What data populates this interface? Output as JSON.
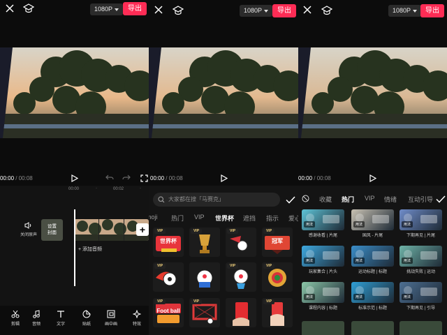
{
  "resolution": "1080P",
  "export_label": "导出",
  "time": {
    "current": "00:00",
    "total": "/ 00:08"
  },
  "ruler": {
    "mark1": "00:00",
    "mark2": "00:02"
  },
  "editor": {
    "mute_label": "关闭原声",
    "cover_label_1": "设置",
    "cover_label_2": "封面",
    "add_audio_label": "+ 添加音频",
    "add_clip_symbol": "+"
  },
  "toolbar": [
    {
      "icon": "scissors-icon",
      "label": "剪辑"
    },
    {
      "icon": "music-note-icon",
      "label": "音频"
    },
    {
      "icon": "text-icon",
      "label": "文字"
    },
    {
      "icon": "sticker-icon",
      "label": "贴纸"
    },
    {
      "icon": "picture-in-picture-icon",
      "label": "画中画"
    },
    {
      "icon": "effects-icon",
      "label": "特效"
    }
  ],
  "stickers": {
    "search_placeholder": "大家都在搜「马赛克」",
    "tabs": [
      "moji",
      "热门",
      "VIP",
      "世界杯",
      "遮挡",
      "指示",
      "爱心"
    ],
    "active_tab": "世界杯",
    "vip_label": "VIP",
    "items": [
      {
        "name": "world-cup-title-sticker",
        "vip": true,
        "text": "世界杯"
      },
      {
        "name": "trophy-sticker",
        "vip": true
      },
      {
        "name": "kicking-boot-sticker",
        "vip": true
      },
      {
        "name": "champion-sticker",
        "vip": true,
        "text": "冠军"
      },
      {
        "name": "fire-football-sticker",
        "vip": true
      },
      {
        "name": "football-character-sticker",
        "vip": false
      },
      {
        "name": "ball-mascot-sticker",
        "vip": true
      },
      {
        "name": "football-badge-sticker",
        "vip": true
      },
      {
        "name": "football-text-sticker",
        "vip": true,
        "text": "Foot ball"
      },
      {
        "name": "goal-net-sticker",
        "vip": true
      },
      {
        "name": "red-card-sticker",
        "vip": false
      },
      {
        "name": "hand-card-sticker",
        "vip": true
      }
    ]
  },
  "templates": {
    "tabs": [
      "收藏",
      "热门",
      "VIP",
      "情绪",
      "互动引导"
    ],
    "active_tab": "热门",
    "use_label": "用法",
    "items": [
      {
        "caption": "感谢收看 | 片尾",
        "color": "#5ec3d6"
      },
      {
        "caption": "国风 - 片尾",
        "color": "#c9c2b3"
      },
      {
        "caption": "下期再见 | 片尾",
        "color": "#6f8cc9"
      },
      {
        "caption": "玩家集合 | 片头",
        "color": "#3fa9e0"
      },
      {
        "caption": "运动标题 | 标题",
        "color": "#3b8ec9"
      },
      {
        "caption": "挑战失败 | 运动",
        "color": "#6fb4a8"
      },
      {
        "caption": "课程内容 | 标题",
        "color": "#8bc7a8"
      },
      {
        "caption": "标准示范 | 标题",
        "color": "#2f9fd6"
      },
      {
        "caption": "下期再见 | 引导",
        "color": "#4d6f92"
      }
    ]
  },
  "colors": {
    "accent": "#fe2c55",
    "vip_gold": "#f4d27a",
    "background": "#0c0c0c"
  }
}
